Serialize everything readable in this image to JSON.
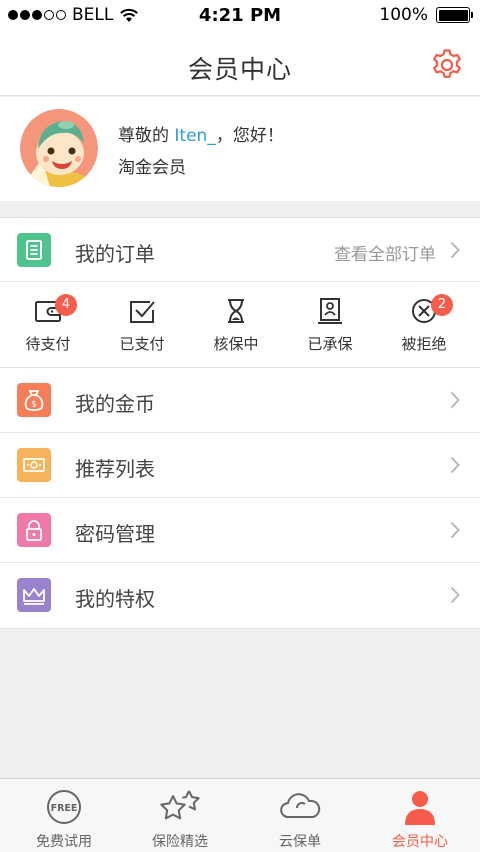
{
  "status_bar": {
    "carrier": "BELL",
    "time": "4:21 PM",
    "battery": "100%"
  },
  "header": {
    "title": "会员中心",
    "settings_icon": "gear-icon"
  },
  "profile": {
    "greeting_prefix": "尊敬的 ",
    "username": "Iten_",
    "greeting_suffix": "，您好！",
    "member_level": "淘金会员"
  },
  "orders": {
    "label": "我的订单",
    "view_all": "查看全部订单",
    "icon_color": "#4fc38e",
    "statuses": [
      {
        "label": "待支付",
        "icon": "wallet-icon",
        "badge": "4"
      },
      {
        "label": "已支付",
        "icon": "check-box-icon",
        "badge": ""
      },
      {
        "label": "核保中",
        "icon": "hourglass-icon",
        "badge": ""
      },
      {
        "label": "已承保",
        "icon": "certificate-icon",
        "badge": ""
      },
      {
        "label": "被拒绝",
        "icon": "rejected-icon",
        "badge": "2"
      }
    ]
  },
  "menu": [
    {
      "label": "我的金币",
      "icon": "coin-bag-icon",
      "color": "#f57d58"
    },
    {
      "label": "推荐列表",
      "icon": "banknote-icon",
      "color": "#f8b45a"
    },
    {
      "label": "密码管理",
      "icon": "lock-icon",
      "color": "#ef79a8"
    },
    {
      "label": "我的特权",
      "icon": "crown-icon",
      "color": "#9b82cf"
    }
  ],
  "tab_bar": {
    "items": [
      {
        "label": "免费试用",
        "icon": "free-icon",
        "active": false
      },
      {
        "label": "保险精选",
        "icon": "stars-icon",
        "active": false
      },
      {
        "label": "云保单",
        "icon": "cloud-icon",
        "active": false
      },
      {
        "label": "会员中心",
        "icon": "user-icon",
        "active": true
      }
    ],
    "active_color": "#f55c4a"
  }
}
